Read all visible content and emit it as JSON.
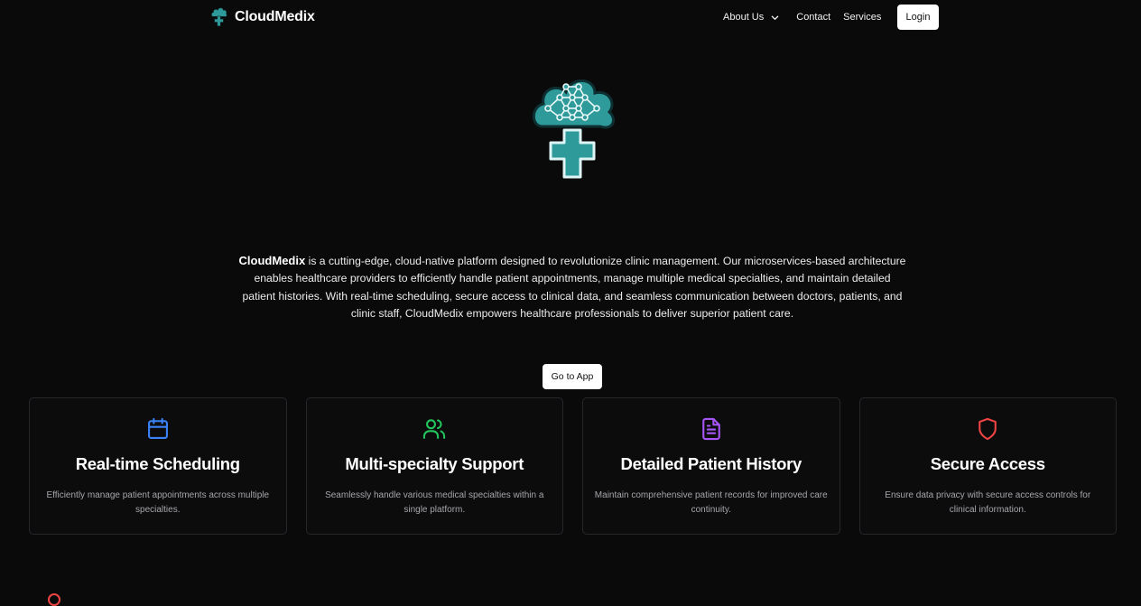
{
  "navbar": {
    "brand": "CloudMedix",
    "links": [
      "About Us",
      "Contact",
      "Services"
    ],
    "login_label": "Login"
  },
  "hero": {
    "description_brand": "CloudMedix",
    "description_text": " is a cutting-edge, cloud-native platform designed to revolutionize clinic management. Our microservices-based architecture enables healthcare providers to efficiently handle patient appointments, manage multiple medical specialties, and maintain detailed patient histories. With real-time scheduling, secure access to clinical data, and seamless communication between doctors, patients, and clinic staff, CloudMedix empowers healthcare professionals to deliver superior patient care.",
    "cta_label": "Go to App"
  },
  "features": [
    {
      "icon": "calendar-icon",
      "color": "#3b82f6",
      "title": "Real-time Scheduling",
      "description": "Efficiently manage patient appointments across multiple specialties."
    },
    {
      "icon": "users-icon",
      "color": "#22c55e",
      "title": "Multi-specialty Support",
      "description": "Seamlessly handle various medical specialties within a single platform."
    },
    {
      "icon": "file-text-icon",
      "color": "#a855f7",
      "title": "Detailed Patient History",
      "description": "Maintain comprehensive patient records for improved care continuity."
    },
    {
      "icon": "shield-icon",
      "color": "#ef4444",
      "title": "Secure Access",
      "description": "Ensure data privacy with secure access controls for clinical information."
    }
  ],
  "colors": {
    "background": "#0a0a0b",
    "brand_teal": "#2f9a9a",
    "card_border": "#26272b"
  }
}
